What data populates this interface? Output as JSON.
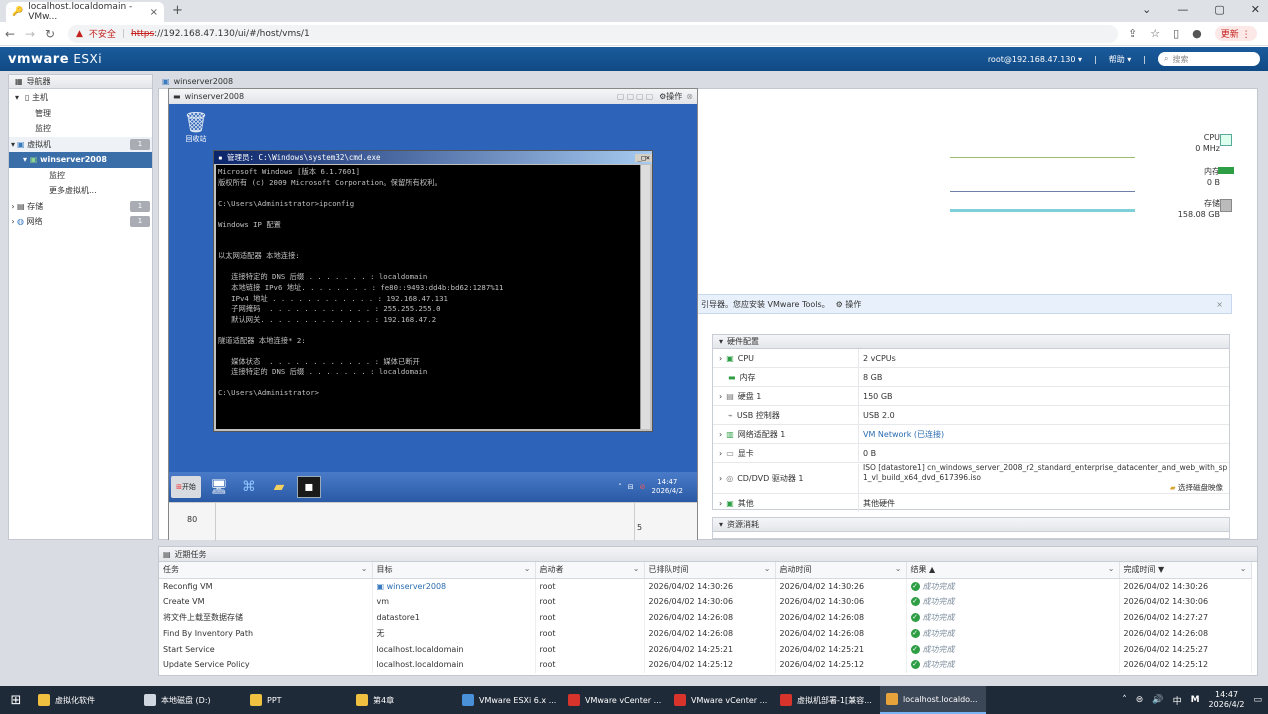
{
  "browser": {
    "tab_title": "localhost.localdomain - VMw...",
    "url_warning": "不安全",
    "url_scheme": "https",
    "url_rest": "://192.168.47.130/ui/#/host/vms/1",
    "update_label": "更新"
  },
  "esxi": {
    "logo_vm": "vmware",
    "logo_product": " ESXi",
    "user": "root@192.168.47.130 ▾",
    "help": "帮助 ▾",
    "search_placeholder": "搜索"
  },
  "navigator": {
    "title": "导航器",
    "items": [
      {
        "label": "主机",
        "badge": ""
      },
      {
        "label": "管理",
        "badge": ""
      },
      {
        "label": "监控",
        "badge": ""
      },
      {
        "label": "虚拟机",
        "badge": "1"
      },
      {
        "label": "winserver2008",
        "badge": ""
      },
      {
        "label": "监控",
        "badge": ""
      },
      {
        "label": "更多虚拟机...",
        "badge": ""
      },
      {
        "label": "存储",
        "badge": "1"
      },
      {
        "label": "网络",
        "badge": "1"
      }
    ]
  },
  "vm": {
    "name": "winserver2008",
    "console_title": "winserver2008",
    "console_actions": "操作",
    "recycle_bin": "回收站",
    "cmd_title": "管理员: C:\\Windows\\system32\\cmd.exe",
    "cmd_lines": [
      "Microsoft Windows [版本 6.1.7601]",
      "版权所有 (c) 2009 Microsoft Corporation。保留所有权利。",
      "",
      "C:\\Users\\Administrator>ipconfig",
      "",
      "Windows IP 配置",
      "",
      "",
      "以太网适配器 本地连接:",
      "",
      "   连接特定的 DNS 后缀 . . . . . . . : localdomain",
      "   本地链接 IPv6 地址. . . . . . . . : fe80::9493:dd4b:bd62:1287%11",
      "   IPv4 地址 . . . . . . . . . . . . : 192.168.47.131",
      "   子网掩码  . . . . . . . . . . . . : 255.255.255.0",
      "   默认网关. . . . . . . . . . . . . : 192.168.47.2",
      "",
      "隧道适配器 本地连接* 2:",
      "",
      "   媒体状态  . . . . . . . . . . . . : 媒体已断开",
      "   连接特定的 DNS 后缀 . . . . . . . : localdomain",
      "",
      "C:\\Users\\Administrator>"
    ],
    "start_label": "开始",
    "guest_clock_time": "14:47",
    "guest_clock_date": "2026/4/2",
    "chart_tick_80": "80",
    "chart_tick_5": "5"
  },
  "resources": {
    "cpu_label": "CPU",
    "cpu_value": "0 MHz",
    "mem_label": "内存",
    "mem_value": "0 B",
    "storage_label": "存储",
    "storage_value": "158.08 GB"
  },
  "infobar": {
    "text": "引导器。您应安装 VMware Tools。",
    "action": "操作"
  },
  "hardware": {
    "title": "硬件配置",
    "rows": [
      {
        "key": "CPU",
        "value": "2 vCPUs"
      },
      {
        "key": "内存",
        "value": "8 GB"
      },
      {
        "key": "硬盘 1",
        "value": "150 GB"
      },
      {
        "key": "USB 控制器",
        "value": "USB 2.0"
      },
      {
        "key": "网络适配器 1",
        "value": "VM Network (已连接)"
      },
      {
        "key": "显卡",
        "value": "0 B"
      },
      {
        "key": "CD/DVD 驱动器 1",
        "value": "ISO [datastore1] cn_windows_server_2008_r2_standard_enterprise_datacenter_and_web_with_sp1_vl_build_x64_dvd_617396.iso",
        "extra": "选择磁盘映像"
      },
      {
        "key": "其他",
        "value": "其他硬件"
      }
    ],
    "resource_title": "资源消耗"
  },
  "tasks": {
    "title": "近期任务",
    "columns": [
      "任务",
      "目标",
      "启动者",
      "已排队时间",
      "启动时间",
      "结果 ▲",
      "完成时间 ▼"
    ],
    "rows": [
      [
        "Reconfig VM",
        "winserver2008",
        "root",
        "2026/04/02 14:30:26",
        "2026/04/02 14:30:26",
        "成功完成",
        "2026/04/02 14:30:26"
      ],
      [
        "Create VM",
        "vm",
        "root",
        "2026/04/02 14:30:06",
        "2026/04/02 14:30:06",
        "成功完成",
        "2026/04/02 14:30:06"
      ],
      [
        "将文件上载至数据存储",
        "datastore1",
        "root",
        "2026/04/02 14:26:08",
        "2026/04/02 14:26:08",
        "成功完成",
        "2026/04/02 14:27:27"
      ],
      [
        "Find By Inventory Path",
        "无",
        "root",
        "2026/04/02 14:26:08",
        "2026/04/02 14:26:08",
        "成功完成",
        "2026/04/02 14:26:08"
      ],
      [
        "Start Service",
        "localhost.localdomain",
        "root",
        "2026/04/02 14:25:21",
        "2026/04/02 14:25:21",
        "成功完成",
        "2026/04/02 14:25:27"
      ],
      [
        "Update Service Policy",
        "localhost.localdomain",
        "root",
        "2026/04/02 14:25:12",
        "2026/04/02 14:25:12",
        "成功完成",
        "2026/04/02 14:25:12"
      ]
    ]
  },
  "taskbar": {
    "items": [
      {
        "label": "虚拟化软件",
        "color": "#f0c040"
      },
      {
        "label": "本地磁盘 (D:)",
        "color": "#cfd6df"
      },
      {
        "label": "PPT",
        "color": "#f0c040"
      },
      {
        "label": "第4章",
        "color": "#f0c040"
      },
      {
        "label": "VMware ESXi 6.x ...",
        "color": "#4a90d9"
      },
      {
        "label": "VMware vCenter ...",
        "color": "#d9342b"
      },
      {
        "label": "VMware vCenter ...",
        "color": "#d9342b"
      },
      {
        "label": "虚拟机部署-1[兼容...",
        "color": "#d9342b"
      },
      {
        "label": "localhost.localdo...",
        "color": "#e8a23a"
      }
    ],
    "ime": "中",
    "time": "14:47",
    "date": "2026/4/2"
  }
}
